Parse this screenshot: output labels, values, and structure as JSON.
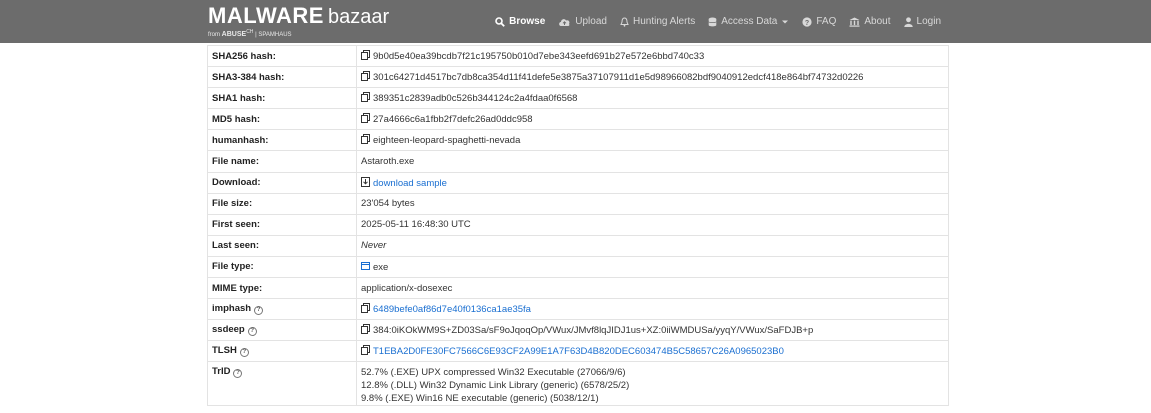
{
  "brand": {
    "name": "MALWARE",
    "suffix": "bazaar",
    "subtitle_prefix": "from",
    "subtitle_org": "ABUSE",
    "subtitle_sup": "CH",
    "subtitle_partner": "SPAMHAUS"
  },
  "nav": [
    {
      "label": "Browse",
      "icon": "search-icon",
      "active": true
    },
    {
      "label": "Upload",
      "icon": "cloud-upload-icon"
    },
    {
      "label": "Hunting Alerts",
      "icon": "bell-icon"
    },
    {
      "label": "Access Data",
      "icon": "database-icon"
    },
    {
      "label": "FAQ",
      "icon": "question-icon"
    },
    {
      "label": "About",
      "icon": "bank-icon"
    },
    {
      "label": "Login",
      "icon": "user-icon"
    }
  ],
  "rows": [
    {
      "key": "SHA256 hash:",
      "value": "9b0d5e40ea39bcdb7f21c195750b010d7ebe343eefd691b27e572e6bbd740c33"
    },
    {
      "key": "SHA3-384 hash:",
      "value": "301c64271d4517bc7db8ca354d11f41defe5e3875a37107911d1e5d98966082bdf9040912edcf418e864bf74732d0226"
    },
    {
      "key": "SHA1 hash:",
      "value": "389351c2839adb0c526b344124c2a4fdaa0f6568"
    },
    {
      "key": "MD5 hash:",
      "value": "27a4666c6a1fbb2f7defc26ad0ddc958"
    },
    {
      "key": "humanhash:",
      "value": "eighteen-leopard-spaghetti-nevada"
    },
    {
      "key": "File name:",
      "value": "Astaroth.exe"
    },
    {
      "key": "Download:",
      "value": "download sample"
    },
    {
      "key": "File size:",
      "value": "23'054 bytes"
    },
    {
      "key": "First seen:",
      "value": "2025-05-11 16:48:30 UTC"
    },
    {
      "key": "Last seen:",
      "value": "Never"
    },
    {
      "key": "File type:",
      "value": "exe"
    },
    {
      "key": "MIME type:",
      "value": "application/x-dosexec"
    },
    {
      "key": "imphash",
      "value": "6489befe0af86d7e40f0136ca1ae35fa"
    },
    {
      "key": "ssdeep",
      "value": "384:0iKOkWM9S+ZD03Sa/sF9oJqoqOp/VWux/JMvf8lqJIDJ1us+XZ:0iiWMDUSa/yyqY/VWux/SaFDJB+p"
    },
    {
      "key": "TLSH",
      "value": "T1EBA2D0FE30FC7566C6E93CF2A99E1A7F63D4B820DEC603474B5C58657C26A0965023B0"
    },
    {
      "key": "TrID",
      "lines": [
        "52.7% (.EXE) UPX compressed Win32 Executable (27066/9/6)",
        "12.8% (.DLL) Win32 Dynamic Link Library (generic) (6578/25/2)",
        "9.8% (.EXE) Win16 NE executable (generic) (5038/12/1)"
      ]
    }
  ],
  "colors": {
    "navbar": "#6c6c6c",
    "link": "#1a6fd1"
  }
}
